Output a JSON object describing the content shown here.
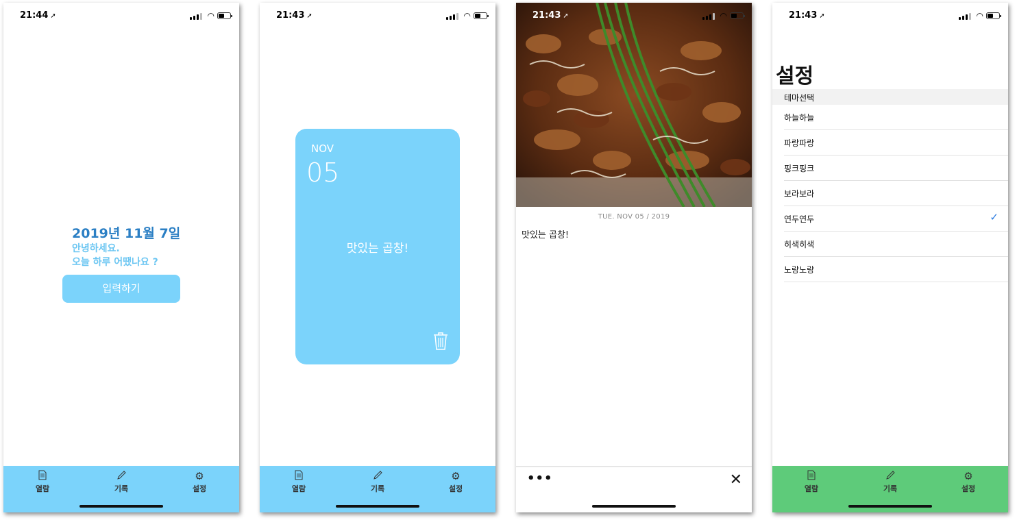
{
  "tabs": {
    "browse": "열람",
    "record": "기록",
    "settings": "설정"
  },
  "screen1": {
    "time": "21:44",
    "date": "2019년 11월 7일",
    "greeting_line1": "안녕하세요.",
    "greeting_line2": "오늘 하루 어땠나요 ?",
    "enter_button": "입력하기"
  },
  "screen2": {
    "time": "21:43",
    "card": {
      "month": "NOV",
      "day": "05",
      "text": "맛있는 곱창!"
    }
  },
  "screen3": {
    "time": "21:43",
    "date": "TUE. NOV 05 / 2019",
    "text": "맛있는 곱창!",
    "more": "•••",
    "close": "✕"
  },
  "screen4": {
    "time": "21:43",
    "title": "설정",
    "section": "테마선택",
    "themes": [
      "하늘하늘",
      "파랑파랑",
      "핑크핑크",
      "보라보라",
      "연두연두",
      "히색히색",
      "노랑노랑"
    ],
    "selected_index": 4
  },
  "colors": {
    "sky": "#7bd3fb",
    "green": "#5ecb7a",
    "date_blue": "#2b7fc4",
    "check_blue": "#2a7be0"
  },
  "icons": {
    "browse": "document-icon",
    "record": "pencil-icon",
    "settings": "gear-icon",
    "delete": "trash-icon"
  }
}
